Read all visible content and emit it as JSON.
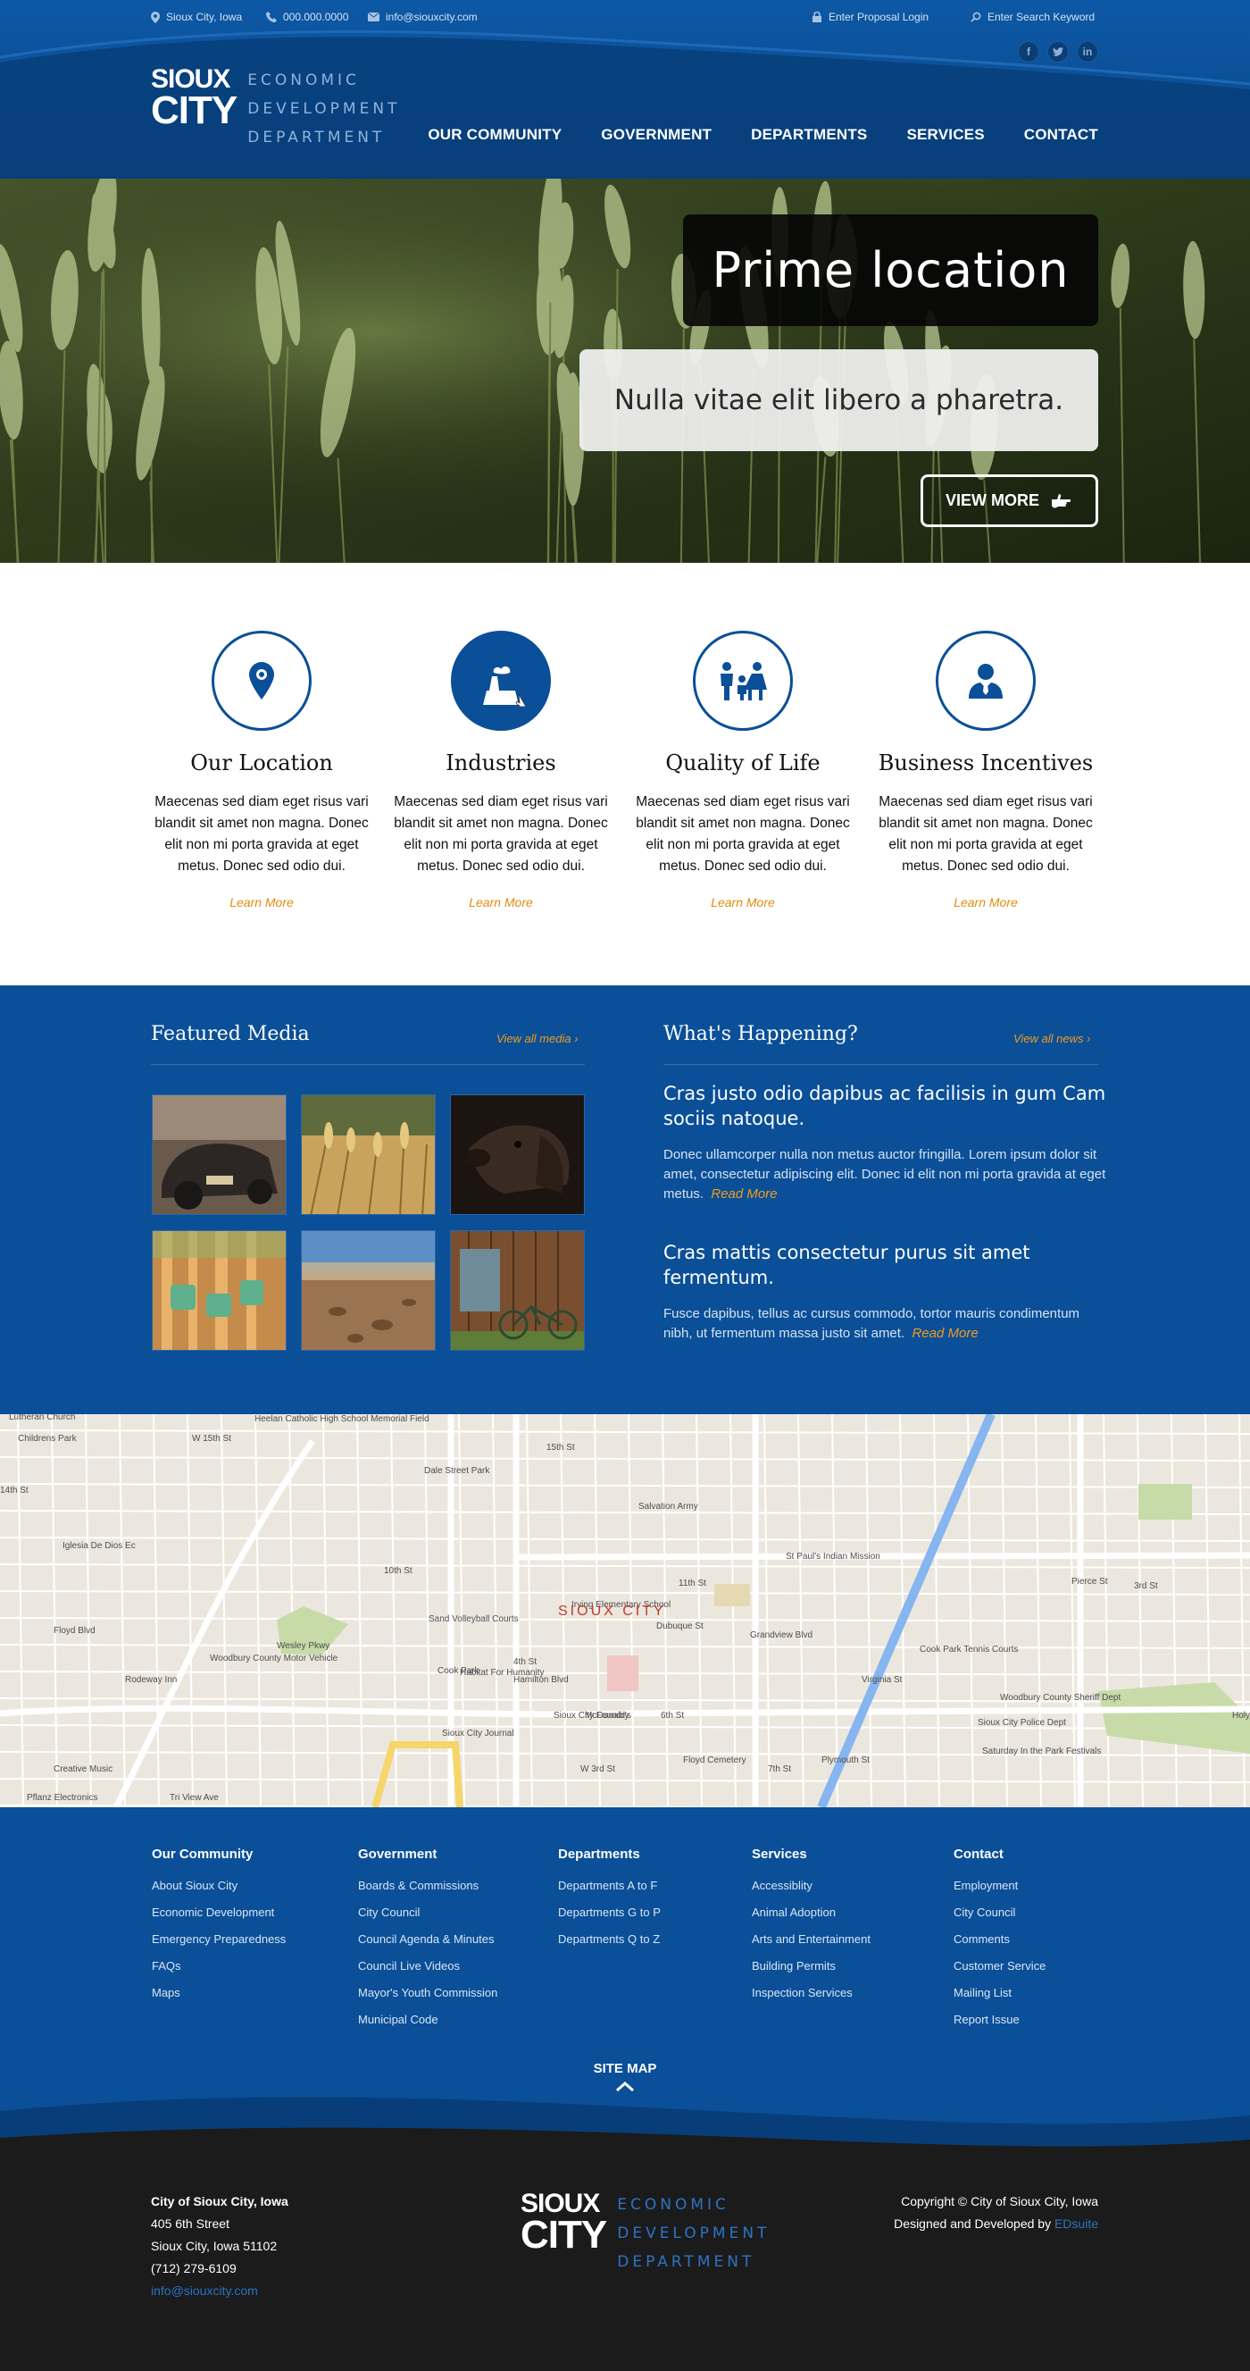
{
  "topbar": {
    "location": "Sioux City, Iowa",
    "phone": "000.000.0000",
    "email": "info@siouxcity.com",
    "proposal_login": "Enter Proposal Login",
    "search_placeholder": "Enter Search Keyword",
    "social": [
      "f",
      "t",
      "in"
    ]
  },
  "logo": {
    "line1": "SIOUX",
    "line2": "CITY",
    "dept1": "ECONOMIC",
    "dept2": "DEVELOPMENT",
    "dept3": "DEPARTMENT"
  },
  "nav": [
    "OUR COMMUNITY",
    "GOVERNMENT",
    "DEPARTMENTS",
    "SERVICES",
    "CONTACT"
  ],
  "hero": {
    "title": "Prime location",
    "subtitle": "Nulla vitae elit libero a pharetra.",
    "button": "VIEW MORE"
  },
  "features": [
    {
      "icon": "map-pin-icon",
      "title": "Our Location",
      "text": "Maecenas sed diam eget risus vari blandit sit amet non magna. Donec elit non mi porta gravida at eget metus. Donec sed odio dui.",
      "link": "Learn More"
    },
    {
      "icon": "factory-icon",
      "title": "Industries",
      "text": "Maecenas sed diam eget risus vari blandit sit amet non magna. Donec elit non mi porta gravida at eget metus. Donec sed odio dui.",
      "link": "Learn More"
    },
    {
      "icon": "family-icon",
      "title": "Quality of Life",
      "text": "Maecenas sed diam eget risus vari blandit sit amet non magna. Donec elit non mi porta gravida at eget metus. Donec sed odio dui.",
      "link": "Learn More"
    },
    {
      "icon": "businessman-icon",
      "title": "Business Incentives",
      "text": "Maecenas sed diam eget risus vari blandit sit amet non magna. Donec elit non mi porta gravida at eget metus. Donec sed odio dui.",
      "link": "Learn More"
    }
  ],
  "media": {
    "heading": "Featured Media",
    "view_all": "View all media"
  },
  "news": {
    "heading": "What's Happening?",
    "view_all": "View all news",
    "items": [
      {
        "title": "Cras justo odio dapibus ac facilisis in gum Cam sociis natoque.",
        "text": "Donec ullamcorper nulla non metus auctor fringilla. Lorem ipsum dolor sit amet, consectetur adipiscing elit. Donec id elit non mi porta gravida at eget metus.",
        "more": "Read More"
      },
      {
        "title": "Cras mattis consectetur purus sit amet fermentum.",
        "text": "Fusce dapibus, tellus ac cursus commodo, tortor mauris condimentum nibh, ut fermentum massa justo sit amet.",
        "more": "Read More"
      }
    ]
  },
  "map": {
    "city": "SIOUX CITY",
    "labels": [
      "Lutheran Church",
      "Heelan Catholic High School Memorial Field",
      "Childrens Park",
      "W 15th St",
      "15th St",
      "Dale Street Park",
      "14th St",
      "Salvation Army",
      "Iglesia De Dios Ec",
      "St Paul's Indian Mission",
      "11th St",
      "Irving Elementary School",
      "10th St",
      "Sand Volleyball Courts",
      "Wesley Pkwy",
      "Woodbury County Motor Vehicle",
      "Cook Park",
      "Cook Park Tennis Courts",
      "Woodbury County Sheriff Dept",
      "Sioux City Foundry",
      "McDonald's",
      "6th St",
      "Sioux City Police Dept",
      "Holy Trinity Greek Orthodox",
      "Sioux City Journal",
      "Floyd Cemetery",
      "Saturday In the Park Festivals",
      "Creative Music",
      "Pflanz Electronics",
      "Tri View Ave",
      "Rodeway Inn",
      "Habitat For Humanity",
      "Hamilton Blvd",
      "Grandview Blvd",
      "Pierce St",
      "Floyd Blvd",
      "Plymouth St",
      "W 3rd St",
      "4th St",
      "3rd St",
      "7th St",
      "Dubuque St",
      "Virginia St"
    ]
  },
  "footer": {
    "columns": [
      {
        "title": "Our Community",
        "links": [
          "About Sioux City",
          "Economic Development",
          "Emergency Preparedness",
          "FAQs",
          "Maps"
        ]
      },
      {
        "title": "Government",
        "links": [
          "Boards & Commissions",
          "City Council",
          "Council Agenda & Minutes",
          "Council Live Videos",
          "Mayor's Youth Commission",
          "Municipal Code"
        ]
      },
      {
        "title": "Departments",
        "links": [
          "Departments A to F",
          "Departments G to P",
          "Departments Q to Z"
        ]
      },
      {
        "title": "Services",
        "links": [
          "Accessiblity",
          "Animal Adoption",
          "Arts and Entertainment",
          "Building Permits",
          "Inspection Services"
        ]
      },
      {
        "title": "Contact",
        "links": [
          "Employment",
          "City Council",
          "Comments",
          "Customer Service",
          "Mailing List",
          "Report Issue"
        ]
      }
    ],
    "site_map": "SITE MAP"
  },
  "bottom": {
    "org": "City of Sioux City, Iowa",
    "street": "405 6th Street",
    "city": "Sioux City, Iowa 51102",
    "phone": "(712) 279-6109",
    "email": "info@siouxcity.com",
    "copyright": "Copyright © City of Sioux City, Iowa",
    "designed": "Designed and Developed by",
    "designer": "EDsuite"
  },
  "colors": {
    "brand_blue": "#0a4f98",
    "accent_orange": "#e28b10",
    "footer_dark": "#1b1b1b"
  }
}
